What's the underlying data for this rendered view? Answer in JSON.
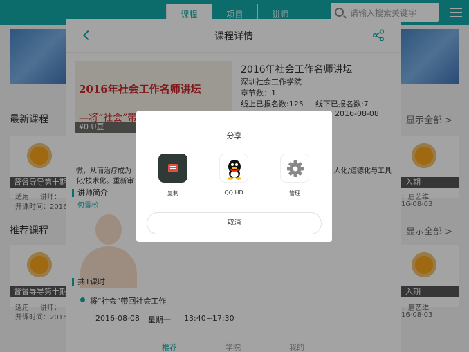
{
  "topbar": {
    "tabs": [
      "课程",
      "项目",
      "讲师"
    ],
    "search_placeholder": "请输入搜索关键字"
  },
  "home": {
    "latest_title": "最新课程",
    "recommend_title": "推荐课程",
    "show_all": "显示全部 >",
    "cards": [
      {
        "strip": "督督导导第十期",
        "l1a": "适用",
        "l1b": "讲师：",
        "l2": "开课时间：2016"
      },
      {
        "strip": "入期",
        "l1a": "",
        "l1b": "：唐艺维",
        "l2": "16-08-03"
      },
      {
        "strip": "督督导导第十期",
        "l1a": "适用",
        "l1b": "讲师：",
        "l2": "开课时间：2016"
      },
      {
        "strip": "入期",
        "l1a": "",
        "l1b": "：唐艺维",
        "l2": "16-08-03"
      }
    ]
  },
  "detail": {
    "title": "课程详情",
    "cover_text": "2016年社会工作名师讲坛",
    "cover_sub": "—将“社会”带回社会工作",
    "udou": "¥0 U豆",
    "course_name": "2016年社会工作名师讲坛",
    "org": "深圳社会工作学院",
    "chapters": "章节数：1",
    "online_signup": "线上已报名数:125",
    "offline_signup": "线下已报名数:7",
    "date_partial": "2016-08-08",
    "desc_left": "微，从而治疗成为",
    "desc_right": "人化/道德化与工具",
    "desc_line2": "化/技术化。重新审",
    "teacher_section": "讲师简介",
    "teacher_name": "何雪松",
    "lessons_section": "共1课时",
    "lesson_title": "将“社会”带回社会工作",
    "lesson_date": "2016-08-08",
    "lesson_weekday": "星期一",
    "lesson_time": "13:40~17:30",
    "bottom_tabs": [
      "推荐",
      "学院",
      "我的"
    ]
  },
  "share_dialog": {
    "title": "分享",
    "apps": [
      {
        "label": "复制",
        "icon": "copy-icon"
      },
      {
        "label": "QQ HD",
        "icon": "qq-icon"
      },
      {
        "label": "管理",
        "icon": "gear-icon"
      }
    ],
    "cancel": "取消"
  },
  "colors": {
    "accent": "#14a8a8",
    "overlay": "rgba(0,0,0,0.36)"
  }
}
